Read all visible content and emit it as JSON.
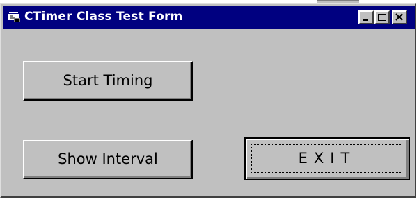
{
  "window": {
    "title": "CTimer Class Test Form",
    "icon": "form-window-icon",
    "caption_buttons": [
      "minimize",
      "maximize",
      "close"
    ]
  },
  "buttons": {
    "start_timing": "Start Timing",
    "show_interval": "Show Interval",
    "exit": "EXIT"
  },
  "colors": {
    "titlebar": "#000080",
    "face": "#c0c0c0",
    "title_text": "#ffffff"
  }
}
